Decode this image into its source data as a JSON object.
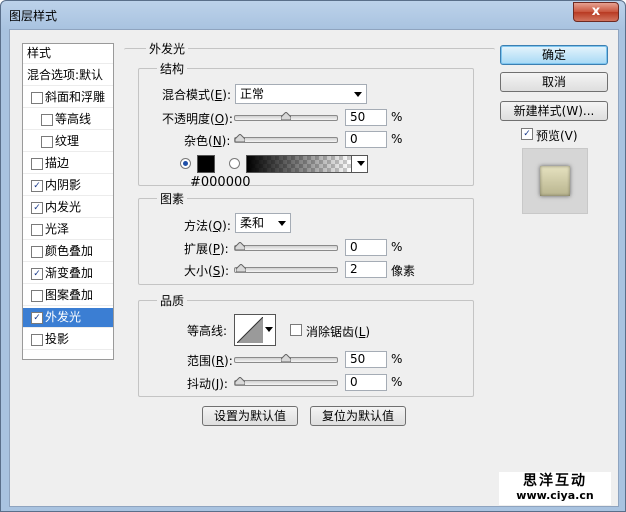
{
  "window": {
    "title": "图层样式",
    "close_glyph": "x"
  },
  "left_list": {
    "header_label": "样式",
    "blend_options_label": "混合选项:默认",
    "items": [
      {
        "label": "斜面和浮雕",
        "checked": false
      },
      {
        "label": "等高线",
        "checked": false
      },
      {
        "label": "纹理",
        "checked": false
      },
      {
        "label": "描边",
        "checked": false
      },
      {
        "label": "内阴影",
        "checked": true
      },
      {
        "label": "内发光",
        "checked": true
      },
      {
        "label": "光泽",
        "checked": false
      },
      {
        "label": "颜色叠加",
        "checked": false
      },
      {
        "label": "渐变叠加",
        "checked": true
      },
      {
        "label": "图案叠加",
        "checked": false
      },
      {
        "label": "外发光",
        "checked": true,
        "selected": true
      },
      {
        "label": "投影",
        "checked": false
      }
    ],
    "check_glyph": "✓"
  },
  "outer_glow": {
    "section_title": "外发光",
    "structure": {
      "title": "结构",
      "blend_mode_label_pre": "混合模式(",
      "blend_mode_key": "E",
      "blend_mode_label_post": "):",
      "blend_mode_value": "正常",
      "opacity_label_pre": "不透明度(",
      "opacity_key": "O",
      "opacity_label_post": "):",
      "opacity_value": "50",
      "opacity_unit": "%",
      "noise_label_pre": "杂色(",
      "noise_key": "N",
      "noise_label_post": "):",
      "noise_value": "0",
      "noise_unit": "%",
      "color_hex": "#000000",
      "color_swatch": "#000000"
    },
    "elements": {
      "title": "图素",
      "technique_label_pre": "方法(",
      "technique_key": "Q",
      "technique_label_post": "):",
      "technique_value": "柔和",
      "spread_label_pre": "扩展(",
      "spread_key": "P",
      "spread_label_post": "):",
      "spread_value": "0",
      "spread_unit": "%",
      "size_label_pre": "大小(",
      "size_key": "S",
      "size_label_post": "):",
      "size_value": "2",
      "size_unit": "像素"
    },
    "quality": {
      "title": "品质",
      "contour_label": "等高线:",
      "antialias_label_pre": "消除锯齿(",
      "antialias_key": "L",
      "antialias_label_post": ")",
      "antialias_checked": false,
      "range_label_pre": "范围(",
      "range_key": "R",
      "range_label_post": "):",
      "range_value": "50",
      "range_unit": "%",
      "jitter_label_pre": "抖动(",
      "jitter_key": "J",
      "jitter_label_post": "):",
      "jitter_value": "0",
      "jitter_unit": "%"
    },
    "make_default_label": "设置为默认值",
    "reset_default_label": "复位为默认值"
  },
  "right_buttons": {
    "ok_label": "确定",
    "cancel_label": "取消",
    "new_style_label": "新建样式(W)...",
    "preview_label": "预览(V)",
    "preview_checked": true
  },
  "watermark": {
    "line1": "思洋互动",
    "line2": "www.ciya.cn"
  }
}
